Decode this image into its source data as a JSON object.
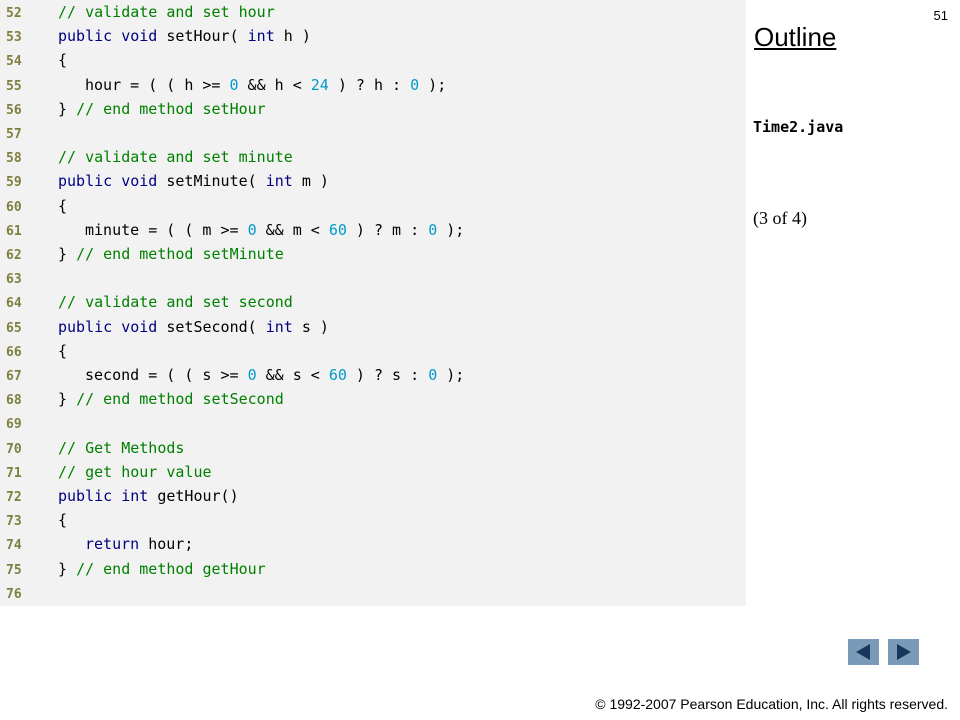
{
  "slide": {
    "number": "51",
    "outline_title": "Outline",
    "file_name": "Time2.java",
    "page_indicator": "(3 of 4)",
    "copyright": "© 1992-2007 Pearson Education, Inc.  All rights reserved."
  },
  "navigation": {
    "prev_icon": "triangle-left-icon",
    "next_icon": "triangle-right-icon",
    "button_color": "#7b9ab8"
  },
  "colors": {
    "keyword": "#000080",
    "comment": "#008000",
    "number": "#0099cc",
    "line_number": "#7f7f3f",
    "code_background": "#f2f2f2"
  },
  "code": [
    {
      "ln": "52",
      "indent": 1,
      "tokens": [
        [
          "cm",
          "// validate and set hour"
        ]
      ]
    },
    {
      "ln": "53",
      "indent": 1,
      "tokens": [
        [
          "kw",
          "public"
        ],
        [
          "tx",
          " "
        ],
        [
          "kw",
          "void"
        ],
        [
          "tx",
          " setHour( "
        ],
        [
          "kw",
          "int"
        ],
        [
          "tx",
          " h )"
        ]
      ]
    },
    {
      "ln": "54",
      "indent": 1,
      "tokens": [
        [
          "tx",
          "{"
        ]
      ]
    },
    {
      "ln": "55",
      "indent": 2,
      "tokens": [
        [
          "tx",
          "hour = ( ( h >= "
        ],
        [
          "num",
          "0"
        ],
        [
          "tx",
          " && h < "
        ],
        [
          "num",
          "24"
        ],
        [
          "tx",
          " ) ? h : "
        ],
        [
          "num",
          "0"
        ],
        [
          "tx",
          " );"
        ]
      ]
    },
    {
      "ln": "56",
      "indent": 1,
      "tokens": [
        [
          "tx",
          "} "
        ],
        [
          "cm",
          "// end method setHour"
        ]
      ]
    },
    {
      "ln": "57",
      "indent": 0,
      "tokens": []
    },
    {
      "ln": "58",
      "indent": 1,
      "tokens": [
        [
          "cm",
          "// validate and set minute"
        ]
      ]
    },
    {
      "ln": "59",
      "indent": 1,
      "tokens": [
        [
          "kw",
          "public"
        ],
        [
          "tx",
          " "
        ],
        [
          "kw",
          "void"
        ],
        [
          "tx",
          " setMinute( "
        ],
        [
          "kw",
          "int"
        ],
        [
          "tx",
          " m )"
        ]
      ]
    },
    {
      "ln": "60",
      "indent": 1,
      "tokens": [
        [
          "tx",
          "{"
        ]
      ]
    },
    {
      "ln": "61",
      "indent": 2,
      "tokens": [
        [
          "tx",
          "minute = ( ( m >= "
        ],
        [
          "num",
          "0"
        ],
        [
          "tx",
          " && m < "
        ],
        [
          "num",
          "60"
        ],
        [
          "tx",
          " ) ? m : "
        ],
        [
          "num",
          "0"
        ],
        [
          "tx",
          " );"
        ]
      ]
    },
    {
      "ln": "62",
      "indent": 1,
      "tokens": [
        [
          "tx",
          "} "
        ],
        [
          "cm",
          "// end method setMinute"
        ]
      ]
    },
    {
      "ln": "63",
      "indent": 0,
      "tokens": []
    },
    {
      "ln": "64",
      "indent": 1,
      "tokens": [
        [
          "cm",
          "// validate and set second"
        ]
      ]
    },
    {
      "ln": "65",
      "indent": 1,
      "tokens": [
        [
          "kw",
          "public"
        ],
        [
          "tx",
          " "
        ],
        [
          "kw",
          "void"
        ],
        [
          "tx",
          " setSecond( "
        ],
        [
          "kw",
          "int"
        ],
        [
          "tx",
          " s )"
        ]
      ]
    },
    {
      "ln": "66",
      "indent": 1,
      "tokens": [
        [
          "tx",
          "{"
        ]
      ]
    },
    {
      "ln": "67",
      "indent": 2,
      "tokens": [
        [
          "tx",
          "second = ( ( s >= "
        ],
        [
          "num",
          "0"
        ],
        [
          "tx",
          " && s < "
        ],
        [
          "num",
          "60"
        ],
        [
          "tx",
          " ) ? s : "
        ],
        [
          "num",
          "0"
        ],
        [
          "tx",
          " );"
        ]
      ]
    },
    {
      "ln": "68",
      "indent": 1,
      "tokens": [
        [
          "tx",
          "} "
        ],
        [
          "cm",
          "// end method setSecond"
        ]
      ]
    },
    {
      "ln": "69",
      "indent": 0,
      "tokens": []
    },
    {
      "ln": "70",
      "indent": 1,
      "tokens": [
        [
          "cm",
          "// Get Methods"
        ]
      ]
    },
    {
      "ln": "71",
      "indent": 1,
      "tokens": [
        [
          "cm",
          "// get hour value"
        ]
      ]
    },
    {
      "ln": "72",
      "indent": 1,
      "tokens": [
        [
          "kw",
          "public"
        ],
        [
          "tx",
          " "
        ],
        [
          "kw",
          "int"
        ],
        [
          "tx",
          " getHour()"
        ]
      ]
    },
    {
      "ln": "73",
      "indent": 1,
      "tokens": [
        [
          "tx",
          "{"
        ]
      ]
    },
    {
      "ln": "74",
      "indent": 2,
      "tokens": [
        [
          "kw",
          "return"
        ],
        [
          "tx",
          " hour;"
        ]
      ]
    },
    {
      "ln": "75",
      "indent": 1,
      "tokens": [
        [
          "tx",
          "} "
        ],
        [
          "cm",
          "// end method getHour"
        ]
      ]
    },
    {
      "ln": "76",
      "indent": 0,
      "tokens": []
    }
  ]
}
